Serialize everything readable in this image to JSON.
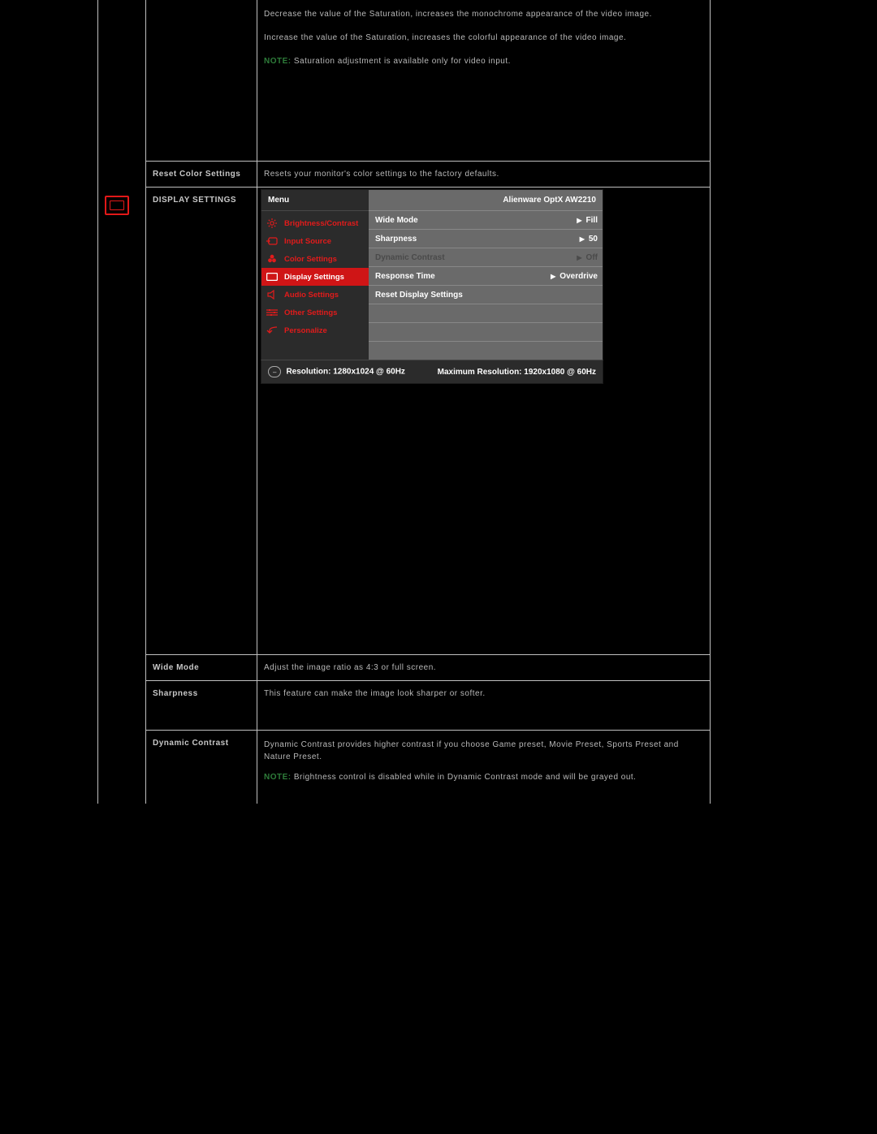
{
  "rows": {
    "sat1": "Decrease the value of the Saturation, increases the monochrome appearance of the video image.",
    "sat2": "Increase the value of the Saturation, increases the colorful appearance of the video image.",
    "sat_note_prefix": "NOTE:",
    "sat_note": " Saturation adjustment is available only for video input.",
    "reset_color_label": "Reset Color Settings",
    "reset_color_desc": "Resets your monitor's color settings to the factory defaults.",
    "display_settings_label": "DISPLAY SETTINGS",
    "wide_mode_label": "Wide Mode",
    "wide_mode_desc": "Adjust the image ratio as 4:3 or full screen.",
    "sharpness_label": "Sharpness",
    "sharpness_desc": "This feature can make the image look sharper or softer.",
    "dyn_label": "Dynamic Contrast",
    "dyn_desc": "Dynamic Contrast provides higher contrast if you choose Game preset, Movie Preset, Sports Preset and Nature Preset.",
    "dyn_note_prefix": "NOTE:",
    "dyn_note": " Brightness control is disabled while in Dynamic Contrast mode and will be grayed out."
  },
  "osd": {
    "menu_title": "Menu",
    "brand": "Alienware OptX AW2210",
    "left_items": [
      {
        "label": "Brightness/Contrast",
        "active": false
      },
      {
        "label": "Input Source",
        "active": false
      },
      {
        "label": "Color Settings",
        "active": false
      },
      {
        "label": "Display Settings",
        "active": true
      },
      {
        "label": "Audio Settings",
        "active": false
      },
      {
        "label": "Other Settings",
        "active": false
      },
      {
        "label": "Personalize",
        "active": false
      }
    ],
    "right_rows": [
      {
        "name": "Wide Mode",
        "value": "Fill",
        "disabled": false
      },
      {
        "name": "Sharpness",
        "value": "50",
        "disabled": false
      },
      {
        "name": "Dynamic Contrast",
        "value": "Off",
        "disabled": true
      },
      {
        "name": "Response Time",
        "value": "Overdrive",
        "disabled": false
      },
      {
        "name": "Reset Display Settings",
        "value": "",
        "disabled": false
      }
    ],
    "bottom_left_label": "Resolution: 1280x1024 @ 60Hz",
    "bottom_right_label": "Maximum Resolution: 1920x1080 @ 60Hz",
    "pill": "–"
  }
}
